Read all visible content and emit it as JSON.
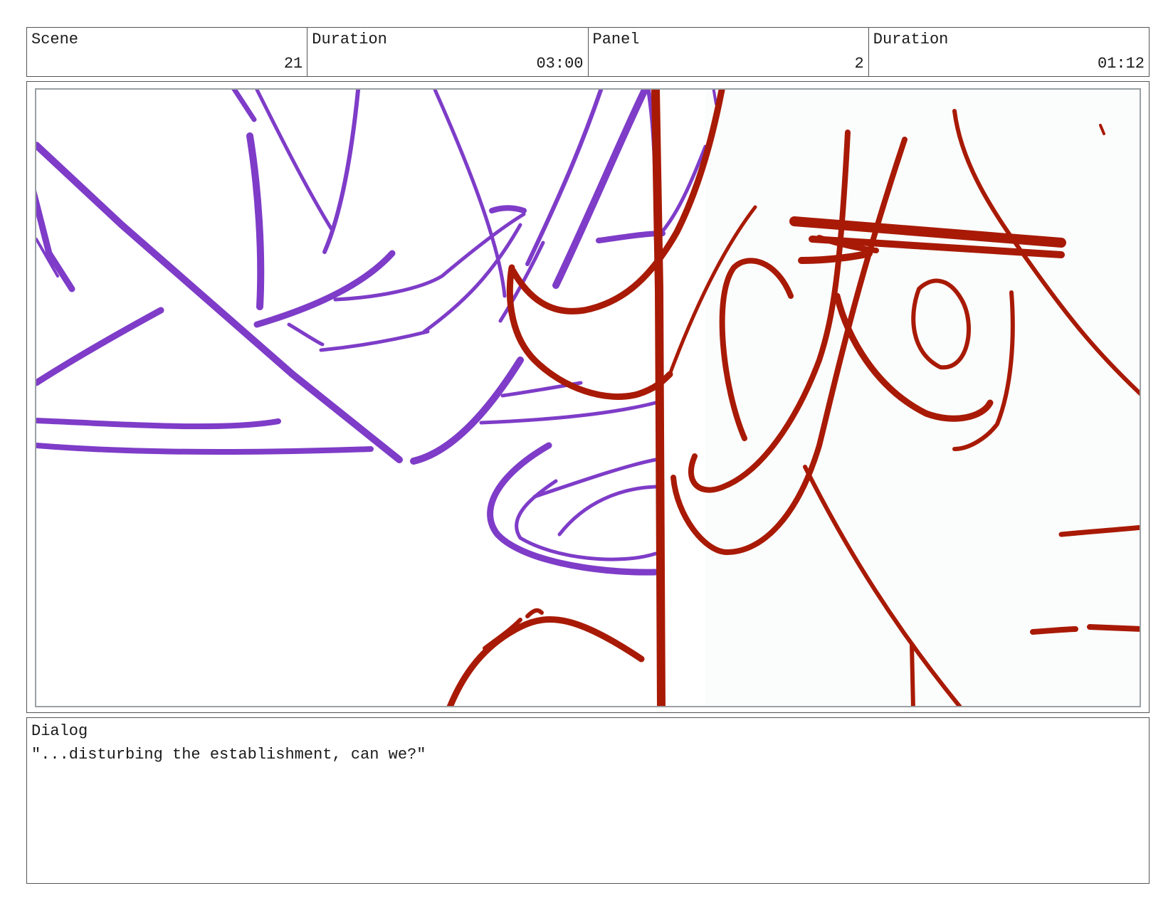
{
  "header": {
    "scene_label": "Scene",
    "scene_value": "21",
    "scene_duration_label": "Duration",
    "scene_duration_value": "03:00",
    "panel_label": "Panel",
    "panel_value": "2",
    "panel_duration_label": "Duration",
    "panel_duration_value": "01:12"
  },
  "panel": {
    "image": "storyboard-sketch",
    "colors": {
      "purple_lines": "#7e3cc8",
      "red_lines": "#a81a05",
      "background_fill": "#fbfdfd"
    }
  },
  "dialog": {
    "label": "Dialog",
    "text": "\"...disturbing the establishment, can we?\""
  }
}
